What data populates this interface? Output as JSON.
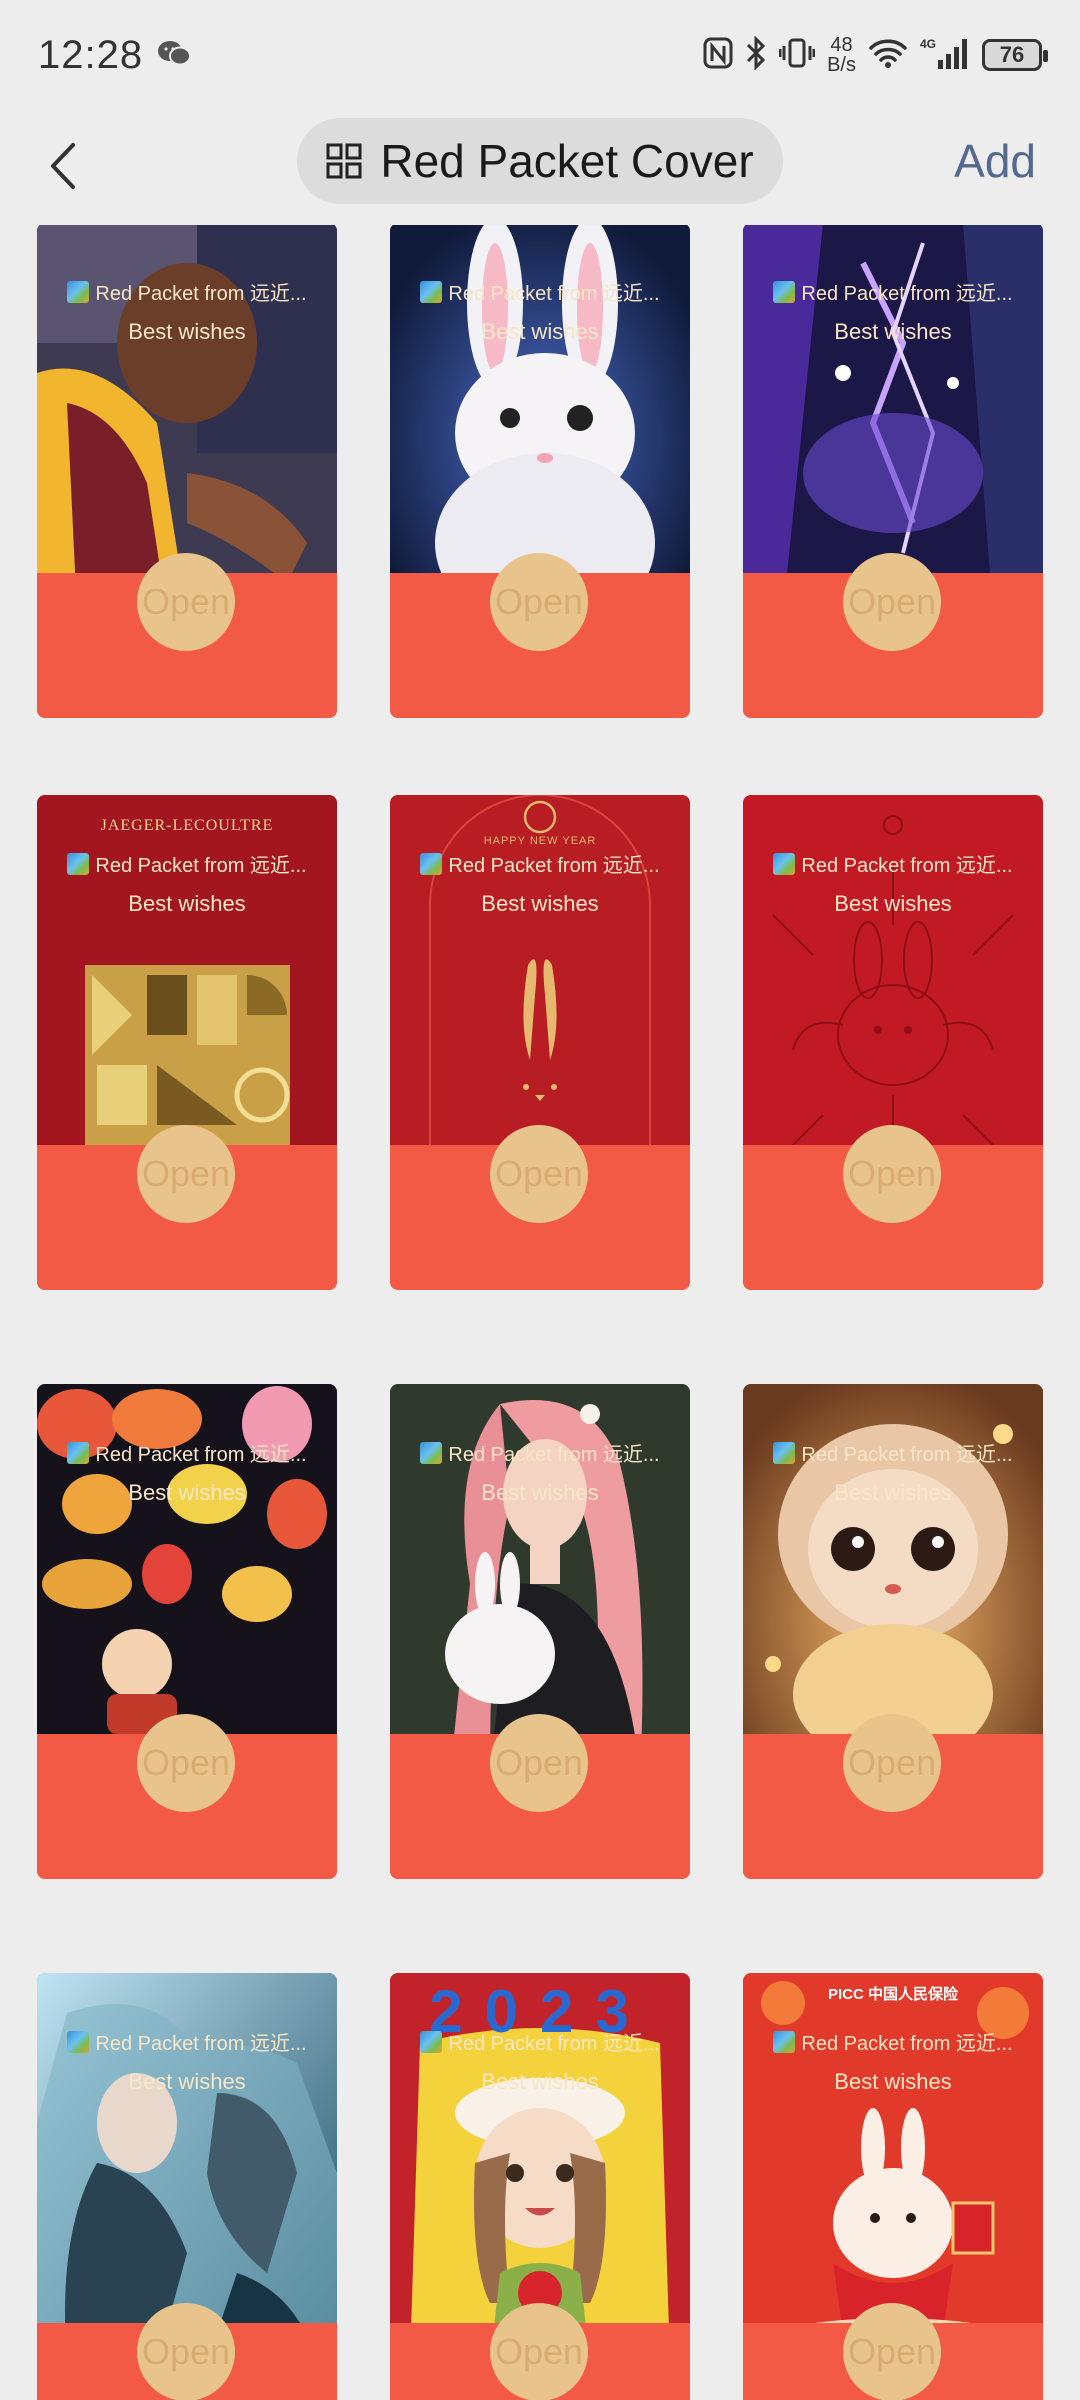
{
  "status_bar": {
    "time": "12:28",
    "net_speed_value": "48",
    "net_speed_unit": "B/s",
    "network": "4G",
    "battery": "76"
  },
  "header": {
    "title": "Red Packet Cover",
    "add_label": "Add"
  },
  "cards": [
    {
      "sender": "Red Packet from 远近...",
      "wishes": "Best wishes",
      "open_label": "Open",
      "art": "basketball-player"
    },
    {
      "sender": "Red Packet from 远近...",
      "wishes": "Best wishes",
      "open_label": "Open",
      "art": "white-rabbit"
    },
    {
      "sender": "Red Packet from 远近...",
      "wishes": "Best wishes",
      "open_label": "Open",
      "art": "purple-lightning"
    },
    {
      "sender": "Red Packet from 远近...",
      "wishes": "Best wishes",
      "open_label": "Open",
      "art": "jaeger-gold-panel",
      "brand": "JAEGER-LECOULTRE"
    },
    {
      "sender": "Red Packet from 远近...",
      "wishes": "Best wishes",
      "open_label": "Open",
      "art": "dji-rabbit-ears",
      "brand": "HAPPY NEW YEAR"
    },
    {
      "sender": "Red Packet from 远近...",
      "wishes": "Best wishes",
      "open_label": "Open",
      "art": "rabbit-line-drawing"
    },
    {
      "sender": "Red Packet from 远近...",
      "wishes": "Best wishes",
      "open_label": "Open",
      "art": "lanterns"
    },
    {
      "sender": "Red Packet from 远近...",
      "wishes": "Best wishes",
      "open_label": "Open",
      "art": "girl-with-rabbit"
    },
    {
      "sender": "Red Packet from 远近...",
      "wishes": "Best wishes",
      "open_label": "Open",
      "art": "fluffy-rabbit"
    },
    {
      "sender": "Red Packet from 远近...",
      "wishes": "Best wishes",
      "open_label": "Open",
      "art": "fantasy-warrior"
    },
    {
      "sender": "Red Packet from 远近...",
      "wishes": "Best wishes",
      "open_label": "Open",
      "art": "girl-2023",
      "brand": "2023"
    },
    {
      "sender": "Red Packet from 远近...",
      "wishes": "Best wishes",
      "open_label": "Open",
      "art": "picc-rabbit",
      "brand": "PICC 中国人民保险"
    }
  ]
}
